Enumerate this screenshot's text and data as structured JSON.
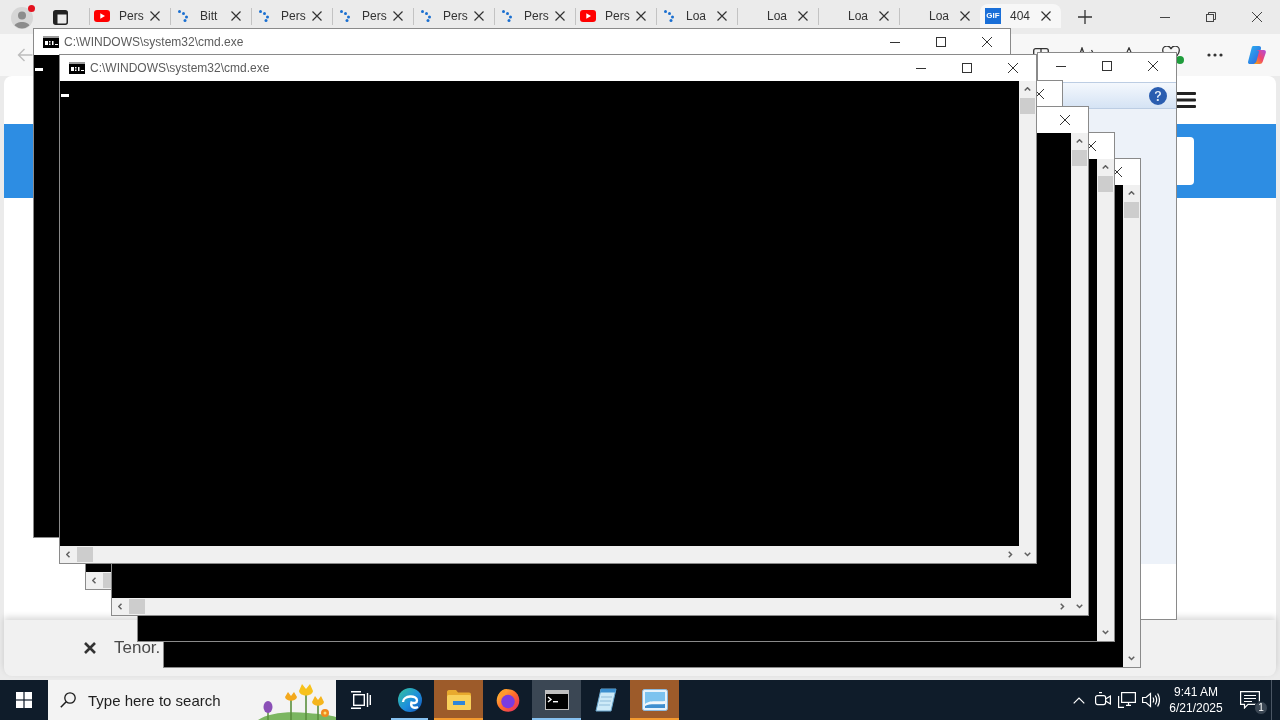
{
  "browser": {
    "profile": {
      "notification": true
    },
    "tabs": [
      {
        "kind": "youtube",
        "label": "Pers",
        "selected": false
      },
      {
        "kind": "loading",
        "label": "Bitt",
        "selected": false
      },
      {
        "kind": "loading",
        "label": "Pers",
        "selected": false
      },
      {
        "kind": "loading",
        "label": "Pers",
        "selected": false
      },
      {
        "kind": "loading",
        "label": "Pers",
        "selected": false
      },
      {
        "kind": "loading",
        "label": "Pers",
        "selected": false
      },
      {
        "kind": "youtube",
        "label": "Pers",
        "selected": false
      },
      {
        "kind": "loading",
        "label": "Loa",
        "selected": false
      },
      {
        "kind": "none",
        "label": "Loa",
        "selected": false
      },
      {
        "kind": "none",
        "label": "Loa",
        "selected": false
      },
      {
        "kind": "none",
        "label": "Loa",
        "selected": false
      },
      {
        "kind": "gif",
        "badge": "GIF",
        "label": "404",
        "selected": true
      }
    ],
    "toolbar": {
      "back_disabled": true
    },
    "page": {
      "bottom_bar": {
        "text": "Tenor."
      }
    }
  },
  "dialog": {
    "buttons": [
      {
        "kind": "minimize"
      },
      {
        "kind": "maximize"
      },
      {
        "kind": "close"
      }
    ],
    "help": true
  },
  "console_windows": [
    {
      "title": "C:\\WINDOWS\\system32\\cmd.exe",
      "buttons": [
        {
          "kind": "minimize"
        },
        {
          "kind": "maximize"
        },
        {
          "kind": "close"
        }
      ],
      "cursor": true
    },
    {
      "title": "C:\\WINDOWS\\system32\\cmd.exe",
      "buttons": [
        {
          "kind": "minimize"
        },
        {
          "kind": "maximize"
        },
        {
          "kind": "close"
        }
      ],
      "cursor": true
    },
    {
      "buttons": [
        {
          "kind": "close"
        }
      ]
    },
    {
      "buttons": [
        {
          "kind": "close"
        }
      ]
    },
    {
      "buttons": [
        {
          "kind": "close"
        }
      ]
    },
    {
      "buttons": [
        {
          "kind": "close"
        }
      ]
    }
  ],
  "taskbar": {
    "search": {
      "placeholder": "Type here to search"
    },
    "apps": [
      {
        "kind": "task-view",
        "running": false,
        "active": false,
        "attention": false
      },
      {
        "kind": "edge",
        "running": true,
        "active": false,
        "attention": false
      },
      {
        "kind": "explorer",
        "running": false,
        "active": false,
        "attention": true
      },
      {
        "kind": "firefox",
        "running": false,
        "active": false,
        "attention": false
      },
      {
        "kind": "terminal",
        "running": true,
        "active": true,
        "attention": false
      },
      {
        "kind": "notepad",
        "running": false,
        "active": false,
        "attention": false
      },
      {
        "kind": "picture",
        "running": false,
        "active": false,
        "attention": true
      }
    ],
    "tray": {
      "time": "9:41 AM",
      "date": "6/21/2025",
      "notifications": "1"
    }
  }
}
